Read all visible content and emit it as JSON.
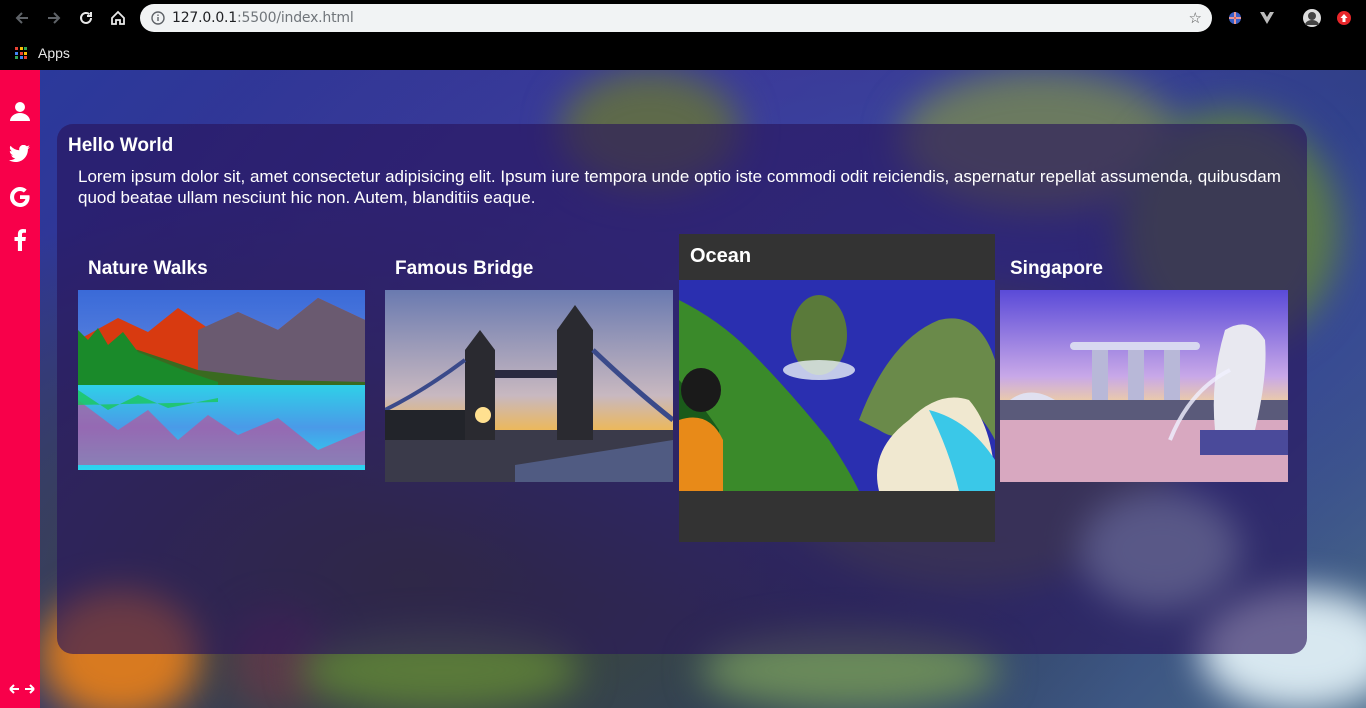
{
  "browser": {
    "url_host": "127.0.0.1",
    "url_rest": ":5500/index.html",
    "bookmarks_apps_label": "Apps"
  },
  "sidebar": {
    "items": [
      {
        "icon": "user-icon"
      },
      {
        "icon": "twitter-icon"
      },
      {
        "icon": "google-icon"
      },
      {
        "icon": "facebook-icon"
      }
    ],
    "toggle_icon": "expand-arrows-icon",
    "color": "#f8004a"
  },
  "panel": {
    "title": "Hello World",
    "text": "Lorem ipsum dolor sit, amet consectetur adipisicing elit. Ipsum iure tempora unde optio iste commodi odit reiciendis, aspernatur repellat assumenda, quibusdam quod beatae ullam nesciunt hic non. Autem, blanditiis eaque."
  },
  "cards": [
    {
      "title": "Nature Walks"
    },
    {
      "title": "Famous Bridge"
    },
    {
      "title": "Ocean"
    },
    {
      "title": "Singapore"
    }
  ]
}
